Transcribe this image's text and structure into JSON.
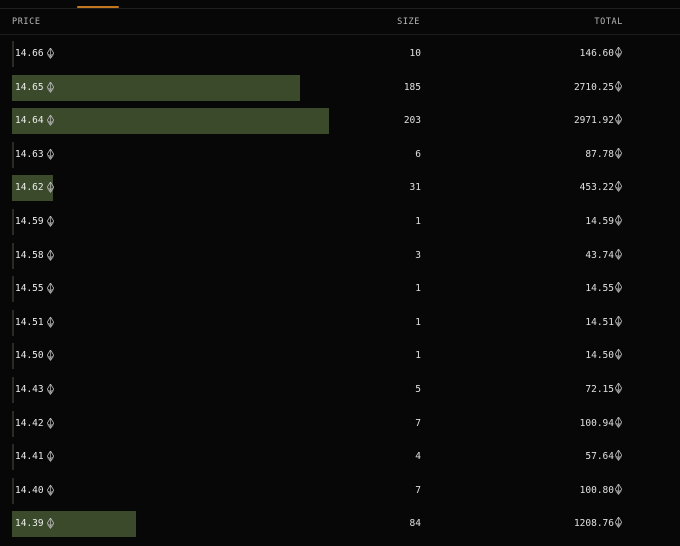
{
  "header": {
    "price_label": "PRICE",
    "size_label": "SIZE",
    "total_label": "TOTAL"
  },
  "colors": {
    "background": "#070707",
    "depth_bar": "#3a4a2a",
    "active_tab": "#c2761f"
  },
  "icons": {
    "currency": "ethereum-icon"
  },
  "rows": [
    {
      "price": "14.66",
      "size": "10",
      "total": "146.60",
      "depth": 0.0
    },
    {
      "price": "14.65",
      "size": "185",
      "total": "2710.25",
      "depth": 0.91
    },
    {
      "price": "14.64",
      "size": "203",
      "total": "2971.92",
      "depth": 1.0
    },
    {
      "price": "14.63",
      "size": "6",
      "total": "87.78",
      "depth": 0.0
    },
    {
      "price": "14.62",
      "size": "31",
      "total": "453.22",
      "depth": 0.13
    },
    {
      "price": "14.59",
      "size": "1",
      "total": "14.59",
      "depth": 0.0
    },
    {
      "price": "14.58",
      "size": "3",
      "total": "43.74",
      "depth": 0.0
    },
    {
      "price": "14.55",
      "size": "1",
      "total": "14.55",
      "depth": 0.0
    },
    {
      "price": "14.51",
      "size": "1",
      "total": "14.51",
      "depth": 0.0
    },
    {
      "price": "14.50",
      "size": "1",
      "total": "14.50",
      "depth": 0.0
    },
    {
      "price": "14.43",
      "size": "5",
      "total": "72.15",
      "depth": 0.0
    },
    {
      "price": "14.42",
      "size": "7",
      "total": "100.94",
      "depth": 0.0
    },
    {
      "price": "14.41",
      "size": "4",
      "total": "57.64",
      "depth": 0.0
    },
    {
      "price": "14.40",
      "size": "7",
      "total": "100.80",
      "depth": 0.0
    },
    {
      "price": "14.39",
      "size": "84",
      "total": "1208.76",
      "depth": 0.39
    }
  ]
}
